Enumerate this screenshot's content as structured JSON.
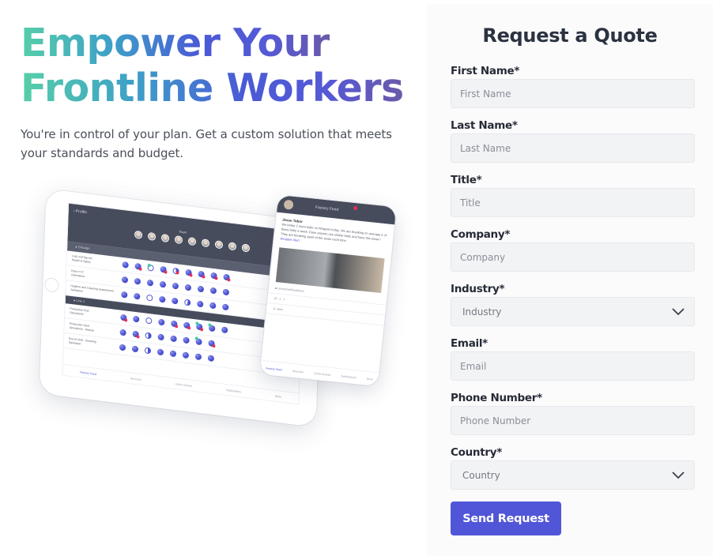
{
  "hero": {
    "title_line1": "Empower Your",
    "title_line2": "Frontline Workers",
    "subtitle": "You're in control of your plan. Get a custom solution that meets your standards and budget.",
    "gradient_colors": [
      "#56cfa8",
      "#4a5ad6",
      "#6a5aa8"
    ]
  },
  "illustration": {
    "tablet": {
      "back_label": "Profile",
      "team_label": "Team",
      "location_label": "Chicago",
      "rows": [
        {
          "title": "Lock out/Tag out",
          "tag": "Health & Safety"
        },
        {
          "title": "Poka YYY",
          "tag": "Operations"
        },
        {
          "title": "Hygiene and Cleaning Assessment",
          "tag": "Sanitation"
        }
      ],
      "section_label": "Line 1",
      "rows2": [
        {
          "title": "Production End",
          "tag": "Operations"
        },
        {
          "title": "Production Start",
          "tag": "Operations - Startup"
        },
        {
          "title": "End of shift - Cleaning",
          "tag": "Sanitation"
        }
      ],
      "nav": [
        "Factory Feed",
        "Structure",
        "Quick Access",
        "Notifications",
        "More"
      ]
    },
    "phone": {
      "header_title": "Factory Feed",
      "author": "Jesse Tabor",
      "post_text": "We broke 2 more belts on Wrapper today. We are breaking on average 2 of these belts a week. Does anyone use similar belts and have this issue? They are breaking apart at the seam each time.",
      "post_link": "Wrapper Alert",
      "tag": "Downtime/Breakdown",
      "stats": [
        "20",
        "4",
        "1"
      ],
      "likes": "11 Likes",
      "nav": [
        "Factory Feed",
        "Structure",
        "Quick Access",
        "Notifications",
        "More"
      ]
    }
  },
  "form": {
    "title": "Request a Quote",
    "fields": [
      {
        "label": "First Name*",
        "placeholder": "First Name",
        "type": "text"
      },
      {
        "label": "Last Name*",
        "placeholder": "Last Name",
        "type": "text"
      },
      {
        "label": "Title*",
        "placeholder": "Title",
        "type": "text"
      },
      {
        "label": "Company*",
        "placeholder": "Company",
        "type": "text"
      },
      {
        "label": "Industry*",
        "placeholder": "Industry",
        "type": "select"
      },
      {
        "label": "Email*",
        "placeholder": "Email",
        "type": "text"
      },
      {
        "label": "Phone Number*",
        "placeholder": "Phone Number",
        "type": "text"
      },
      {
        "label": "Country*",
        "placeholder": "Country",
        "type": "select"
      }
    ],
    "submit_label": "Send Request",
    "accent_color": "#5056d7"
  }
}
